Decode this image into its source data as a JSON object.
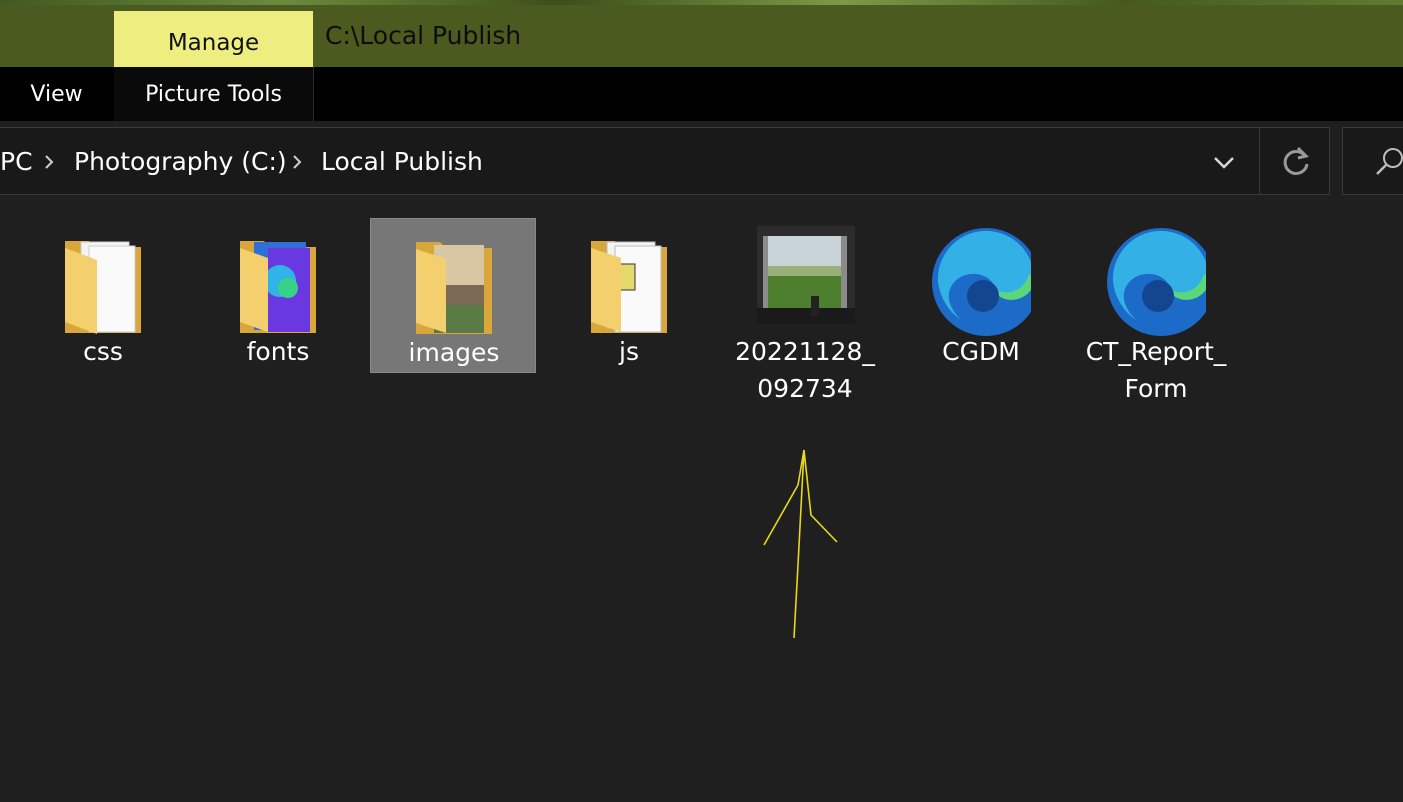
{
  "window": {
    "title": "C:\\Local Publish",
    "context_tab": "Manage"
  },
  "ribbon": {
    "tabs": [
      {
        "label": "View"
      },
      {
        "label": "Picture Tools"
      }
    ]
  },
  "address": {
    "crumbs": [
      "PC",
      "Photography (C:)",
      "Local Publish"
    ]
  },
  "items": [
    {
      "name": "css",
      "type": "folder"
    },
    {
      "name": "fonts",
      "type": "folder"
    },
    {
      "name": "images",
      "type": "folder",
      "selected": true
    },
    {
      "name": "js",
      "type": "folder"
    },
    {
      "name": "20221128_092734",
      "label_lines": [
        "20221128_",
        "092734"
      ],
      "type": "image"
    },
    {
      "name": "CGDM",
      "type": "edge-shortcut"
    },
    {
      "name": "CT_Report_Form",
      "label_lines": [
        "CT_Report_",
        "Form"
      ],
      "type": "edge-shortcut"
    }
  ],
  "colors": {
    "titlebar": "#4b5a1e",
    "manage_tab": "#eeee80",
    "selection": "#777777",
    "annotation": "#e6d81a"
  }
}
